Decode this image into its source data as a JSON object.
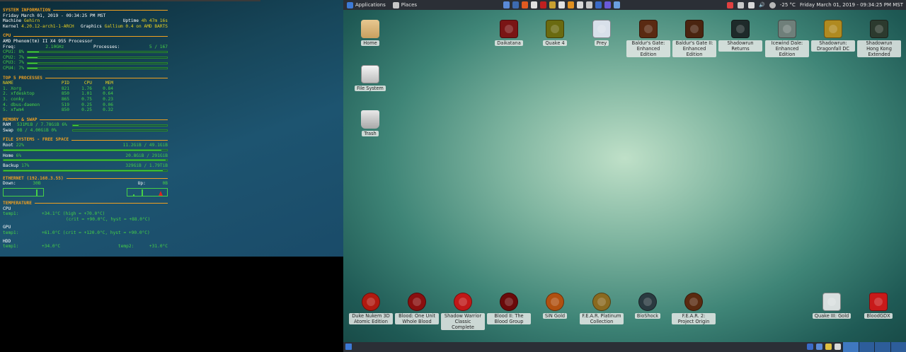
{
  "conky": {
    "sysinfo": {
      "title": "SYSTEM INFORMATION",
      "datetime": "Friday March 01, 2019 - 09:34:25 PM MST",
      "machine_label": "Machine",
      "machine_value": "Gehirn",
      "uptime_label": "Uptime",
      "uptime_value": "4h 47m 16s",
      "kernel_label": "Kernel",
      "kernel_value": "4.20.12-arch1-1-ARCH",
      "graphics_label": "Graphics",
      "graphics_value": "Gallium 0.4 on AMD BARTS"
    },
    "cpu": {
      "title": "CPU",
      "model": "AMD Phenom(tm) II X4 955 Processor",
      "freq_label": "Freq:",
      "freq_value": "2.10GHz",
      "processes_label": "Processes:",
      "processes_value": "5 / 167",
      "cores": [
        {
          "label": "CPU1: 8%",
          "percent": 8
        },
        {
          "label": "CPU2: 7%",
          "percent": 7
        },
        {
          "label": "CPU3: 7%",
          "percent": 7
        },
        {
          "label": "CPU4: 7%",
          "percent": 7
        }
      ]
    },
    "processes": {
      "title": "TOP 5 PROCESSES",
      "headers": [
        "NAME",
        "PID",
        "CPU",
        "MEM"
      ],
      "rows": [
        [
          "1. Xorg",
          "821",
          "1.76",
          "0.84"
        ],
        [
          "2. xfdesktop",
          "850",
          "1.01",
          "0.64"
        ],
        [
          "3. conky",
          "865",
          "0.75",
          "0.23"
        ],
        [
          "4. dbus-daemon",
          "519",
          "0.25",
          "0.06"
        ],
        [
          "5. xfwm4",
          "850",
          "0.25",
          "0.32"
        ]
      ]
    },
    "memory": {
      "title": "MEMORY & SWAP",
      "ram_label": "RAM",
      "ram_value": "531MiB / 7.78GiB 6%",
      "ram_percent": 6,
      "swap_label": "Swap",
      "swap_value": "0B / 4.00GiB 0%",
      "swap_percent": 0
    },
    "filesystems": {
      "title": "FILE SYSTEMS - FREE SPACE",
      "items": [
        {
          "label": "Root",
          "percent_label": "22%",
          "value": "11.2GiB / 49.1GiB",
          "percent": 22
        },
        {
          "label": "Home",
          "percent_label": "6%",
          "value": "20.8GiB / 291GiB",
          "percent": 6
        },
        {
          "label": "Backup",
          "percent_label": "17%",
          "value": "329GiB / 1.79TiB",
          "percent": 17
        }
      ]
    },
    "ethernet": {
      "title": "ETHERNET (192.168.3.55)",
      "down_label": "Down:",
      "down_value": "30B",
      "up_label": "Up:",
      "up_value": "0B"
    },
    "temperature": {
      "title": "TEMPERATURE",
      "cpu_head": "CPU",
      "cpu_temp_label": "temp1:",
      "cpu_temp_line1": "+34.1°C  (high = +70.0°C)",
      "cpu_temp_line2": "(crit = +90.0°C, hyst = +88.0°C)",
      "gpu_head": "GPU",
      "gpu_temp_label": "temp1:",
      "gpu_temp_line": "+61.0°C  (crit = +120.0°C, hyst = +90.0°C)",
      "hdd_head": "HDD",
      "hdd_temp1_label": "temp1:",
      "hdd_temp1_value": "+34.0°C",
      "hdd_temp2_label": "temp2:",
      "hdd_temp2_value": "+31.0°C"
    }
  },
  "panel": {
    "applications_label": "Applications",
    "places_label": "Places",
    "weather": "-25 °C",
    "clock": "Friday March 01, 2019 - 09:34:25 PM MST"
  },
  "desktop": {
    "places": [
      {
        "label": "Home"
      },
      {
        "label": "File System"
      },
      {
        "label": "Trash"
      }
    ],
    "top_games": [
      {
        "label": "Daikatana",
        "color": "#7a1515"
      },
      {
        "label": "Quake 4",
        "color": "#6a6a10"
      },
      {
        "label": "Prey",
        "color": "#d8e0ea"
      },
      {
        "label": "Baldur's Gate: Enhanced Edition",
        "color": "#5a2a12"
      },
      {
        "label": "Baldur's Gate II: Enhanced Edition",
        "color": "#4a2410"
      },
      {
        "label": "Shadowrun Returns",
        "color": "#1e2a2a"
      },
      {
        "label": "Icewind Dale: Enhanced Edition",
        "color": "#6f7f7a"
      },
      {
        "label": "Shadowrun: Dragonfall DC",
        "color": "#b08a20"
      },
      {
        "label": "Shadowrun Hong Kong Extended",
        "color": "#2c3a2e"
      }
    ],
    "bottom_games": [
      {
        "label": "Duke Nukem 3D Atomic Edition",
        "color": "#b01a10"
      },
      {
        "label": "Blood: One Unit Whole Blood",
        "color": "#8a0f0f"
      },
      {
        "label": "Shadow Warrior Classic Complete",
        "color": "#c01818"
      },
      {
        "label": "Blood II: The Blood Group",
        "color": "#6a0a0a"
      },
      {
        "label": "SiN Gold",
        "color": "#b05010"
      },
      {
        "label": "F.E.A.R. Platinum Collection",
        "color": "#8a6a20"
      },
      {
        "label": "BioShock",
        "color": "#2a3a40"
      },
      {
        "label": "F.E.A.R. 2: Project Origin",
        "color": "#5a2a10"
      },
      {
        "label": "Quake III: Gold",
        "color": "#d8dede"
      },
      {
        "label": "BloodGDX",
        "color": "#c81a1a"
      }
    ]
  }
}
